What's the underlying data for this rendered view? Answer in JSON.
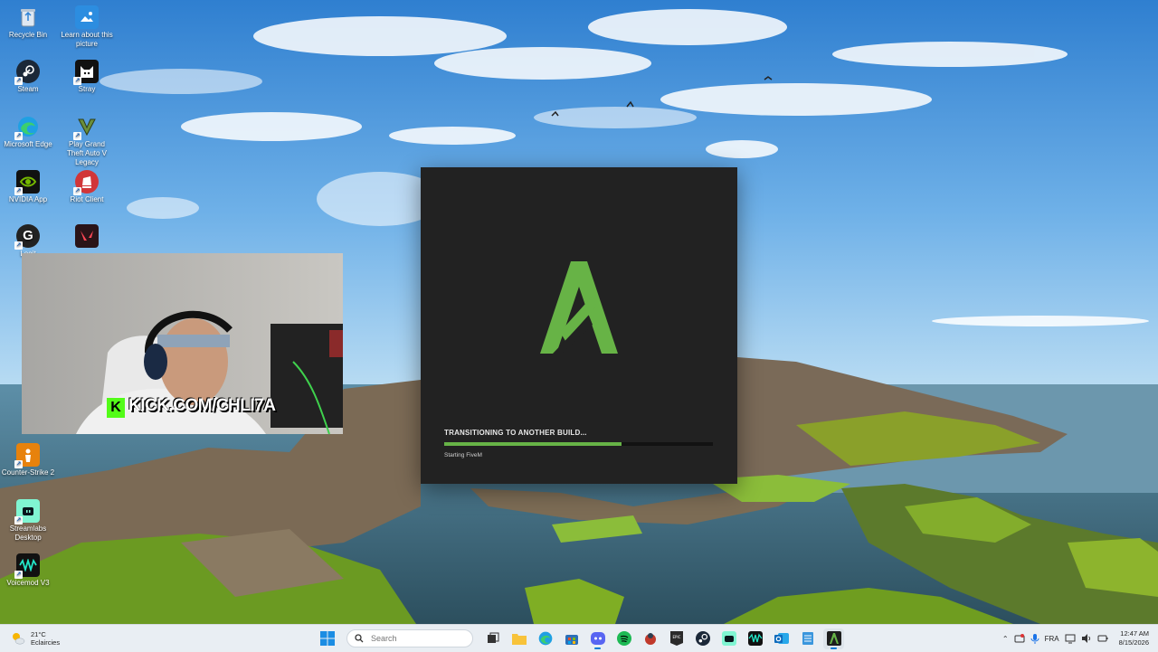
{
  "desktop": {
    "icons": [
      {
        "label": "Recycle Bin",
        "icon": "recycle-bin-icon"
      },
      {
        "label": "Learn about this picture",
        "icon": "picture-info-icon"
      },
      {
        "label": "Steam",
        "icon": "steam-icon"
      },
      {
        "label": "Stray",
        "icon": "stray-icon"
      },
      {
        "label": "Microsoft Edge",
        "icon": "edge-icon"
      },
      {
        "label": "Play Grand Theft Auto V Legacy",
        "icon": "gta-icon"
      },
      {
        "label": "NVIDIA App",
        "icon": "nvidia-icon"
      },
      {
        "label": "Riot Client",
        "icon": "riot-icon"
      },
      {
        "label": "Logit",
        "icon": "logitech-icon"
      },
      {
        "label": "",
        "icon": "valorant-icon"
      },
      {
        "label": "Counter-Strike 2",
        "icon": "cs2-icon"
      },
      {
        "label": "Streamlabs Desktop",
        "icon": "streamlabs-icon"
      },
      {
        "label": "Voicemod V3",
        "icon": "voicemod-icon"
      }
    ]
  },
  "webcam": {
    "overlay_text": "KICK.COM/CHLI7A"
  },
  "loader": {
    "status": "TRANSITIONING TO ANOTHER BUILD...",
    "substatus": "Starting FiveM",
    "progress": 0.66,
    "accent": "#67b346",
    "background": "#222222"
  },
  "taskbar": {
    "weather": {
      "temp": "21°C",
      "condition": "Eclaircies"
    },
    "search_placeholder": "Search",
    "language": "FRA",
    "time": "12:47 AM",
    "date": "8/15/2026",
    "apps": [
      "start-icon",
      "search",
      "task-view-icon",
      "file-explorer-icon",
      "edge-icon",
      "store-icon",
      "discord-icon",
      "spotify-icon",
      "game-icon",
      "epic-games-icon",
      "steam-icon",
      "streamlabs-icon",
      "voicemod-icon",
      "outlook-icon",
      "notepad-icon",
      "fivem-icon"
    ]
  }
}
